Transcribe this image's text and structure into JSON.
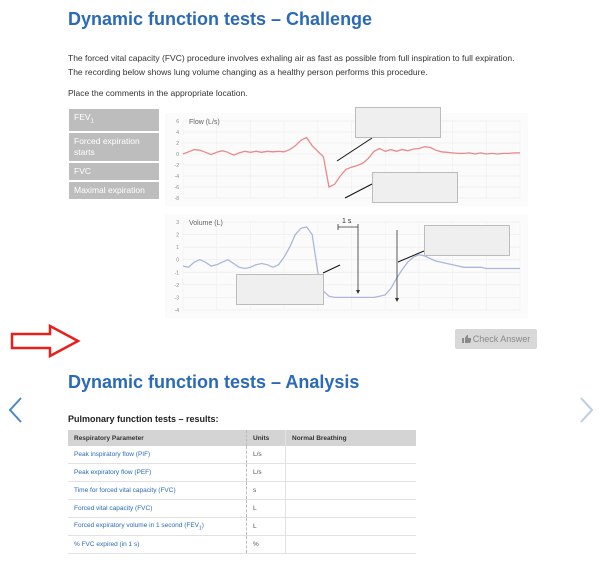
{
  "challenge": {
    "title": "Dynamic function tests – Challenge",
    "description_line1": "The forced vital capacity (FVC) procedure involves exhaling air as fast as possible from full inspiration to full expiration.",
    "description_line2": "The recording below shows lung volume changing as a healthy person performs this procedure.",
    "instruction": "Place the comments in the appropriate location.",
    "comments": [
      {
        "label": "FEV",
        "subscript": "1"
      },
      {
        "label": "Forced expiration starts"
      },
      {
        "label": "FVC"
      },
      {
        "label": "Maximal expiration"
      }
    ],
    "check_answer_label": "Check Answer",
    "check_icon": "thumbs-up-icon"
  },
  "chart_data": [
    {
      "type": "line",
      "title": "",
      "ylabel": "Flow (L/s)",
      "xlabel": "",
      "yticks": [
        "6",
        "4",
        "2",
        "0",
        "-2",
        "-4",
        "-6",
        "-8"
      ],
      "ylim": [
        -8,
        6
      ],
      "grid": true,
      "series": [
        {
          "color": "#e88a8a",
          "x": [
            0,
            0.5,
            1,
            1.5,
            2,
            2.5,
            3,
            3.5,
            4,
            4.5,
            5,
            5.5,
            6,
            6.5,
            7,
            7.5,
            8,
            8.5,
            9,
            9.5,
            10,
            10.5,
            11,
            11.5,
            12,
            12.5,
            13,
            13.5,
            14,
            14.5,
            15,
            15.5,
            16,
            16.5,
            17,
            17.5,
            18,
            18.5,
            19,
            19.5,
            20,
            20.5,
            21,
            21.5,
            22,
            22.5,
            23,
            23.5,
            24,
            24.5,
            25,
            25.5,
            26,
            26.5,
            27,
            27.5,
            28,
            28.5,
            29,
            29.5,
            30
          ],
          "y": [
            0,
            0.4,
            0.8,
            0.7,
            0.3,
            -0.1,
            0.3,
            0.6,
            0.3,
            -0.2,
            0.2,
            0.5,
            0.3,
            0.5,
            0.3,
            0.5,
            0.4,
            0.5,
            0.4,
            0.8,
            1.5,
            2.5,
            3.0,
            1.5,
            0.5,
            -0.5,
            -6.0,
            -5.5,
            -4.0,
            -2.8,
            -2.4,
            -2.1,
            -1.7,
            -0.8,
            0.5,
            1.0,
            0.5,
            0.8,
            0.5,
            0.8,
            0.6,
            0.9,
            1.0,
            1.3,
            1.2,
            0.7,
            0.4,
            0.3,
            0.2,
            0.1,
            0.1,
            0.2,
            0,
            0.2,
            0,
            0.1,
            0,
            0.1,
            0.1,
            0.2,
            0.2
          ]
        }
      ]
    },
    {
      "type": "line",
      "title": "",
      "ylabel": "Volume (L)",
      "xlabel": "",
      "yticks": [
        "3",
        "2",
        "1",
        "0",
        "-1",
        "-2",
        "-3",
        "-4"
      ],
      "ylim": [
        -4,
        3
      ],
      "grid": true,
      "annotation": "1 s",
      "series": [
        {
          "color": "#a9b8dc",
          "x": [
            0,
            0.5,
            1,
            1.5,
            2,
            2.5,
            3,
            3.5,
            4,
            4.5,
            5,
            5.5,
            6,
            6.5,
            7,
            7.5,
            8,
            8.5,
            9,
            9.5,
            10,
            10.5,
            11,
            11.5,
            12,
            12.5,
            13,
            13.5,
            14,
            14.5,
            15,
            15.5,
            16,
            16.5,
            17,
            17.5,
            18,
            18.5,
            19,
            19.5,
            20,
            20.5,
            21,
            21.5,
            22,
            22.5,
            23,
            23.5,
            24,
            24.5,
            25,
            25.5,
            26,
            26.5,
            27,
            27.5,
            28,
            28.5,
            29,
            29.5,
            30
          ],
          "y": [
            -0.5,
            -0.6,
            -0.2,
            0,
            -0.2,
            -0.5,
            -0.4,
            -0.2,
            0,
            -0.3,
            -0.6,
            -0.7,
            -0.6,
            -0.4,
            -0.3,
            -0.4,
            -0.6,
            -0.4,
            0.2,
            1.0,
            2.0,
            2.5,
            2.6,
            2.0,
            -1.0,
            -2.5,
            -2.9,
            -3.0,
            -3.0,
            -3.0,
            -3.0,
            -3.0,
            -3.0,
            -3.0,
            -3.0,
            -2.9,
            -2.8,
            -2.3,
            -1.5,
            -0.8,
            -0.2,
            0.2,
            0.4,
            0.3,
            0.1,
            -0.1,
            -0.2,
            -0.3,
            -0.4,
            -0.5,
            -0.6,
            -0.6,
            -0.6,
            -0.6,
            -0.7,
            -0.7,
            -0.7,
            -0.7,
            -0.7,
            -0.7,
            -0.7
          ]
        }
      ]
    }
  ],
  "analysis": {
    "title": "Dynamic function tests – Analysis",
    "table_title": "Pulmonary function tests – results:",
    "headers": [
      "Respiratory Parameter",
      "Units",
      "Normal Breathing"
    ],
    "rows": [
      {
        "param": "Peak inspiratory flow (PIF)",
        "unit": "L/s",
        "value": ""
      },
      {
        "param": "Peak expiratory flow (PEF)",
        "unit": "L/s",
        "value": ""
      },
      {
        "param": "Time for forced vital capacity (FVC)",
        "unit": "s",
        "value": ""
      },
      {
        "param": "Forced vital capacity (FVC)",
        "unit": "L",
        "value": ""
      },
      {
        "param": "Forced expiratory volume in 1 second (FEV",
        "param_sub": "1",
        "param_end": ")",
        "unit": "L",
        "value": ""
      },
      {
        "param": "% FVC expired (in 1 s)",
        "unit": "%",
        "value": ""
      }
    ]
  },
  "navigation": {
    "prev_icon": "chevron-left-icon",
    "next_icon": "chevron-right-icon",
    "indicator_icon": "red-arrow-right-icon"
  }
}
